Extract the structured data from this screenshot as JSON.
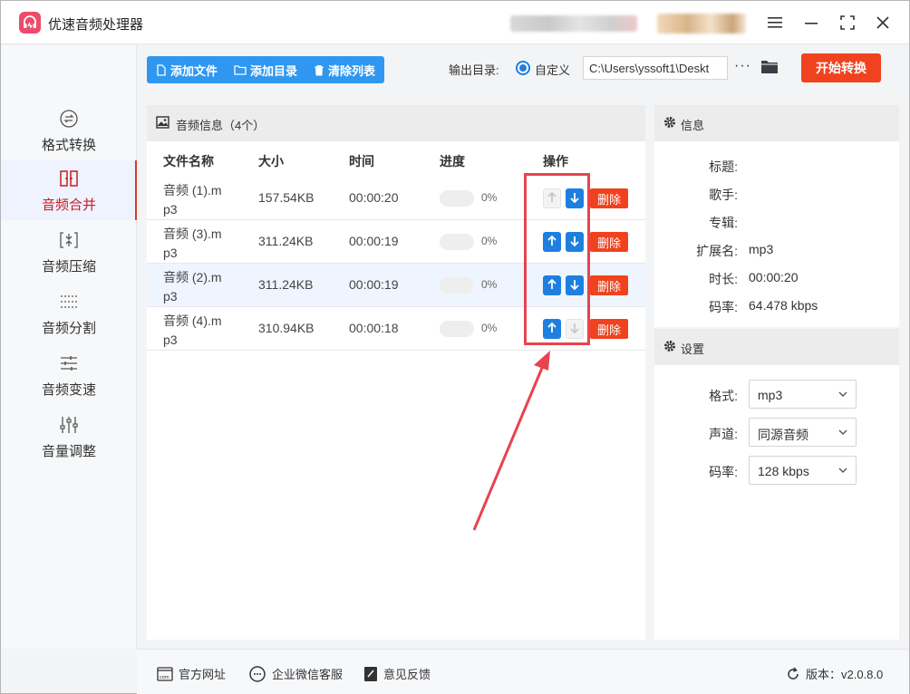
{
  "app": {
    "title": "优速音频处理器"
  },
  "sidebar": {
    "items": [
      {
        "label": "格式转换",
        "icon": "format-convert-icon",
        "active": false
      },
      {
        "label": "音频合并",
        "icon": "merge-icon",
        "active": true
      },
      {
        "label": "音频压缩",
        "icon": "compress-icon",
        "active": false
      },
      {
        "label": "音频分割",
        "icon": "split-icon",
        "active": false
      },
      {
        "label": "音频变速",
        "icon": "speed-icon",
        "active": false
      },
      {
        "label": "音量调整",
        "icon": "volume-icon",
        "active": false
      }
    ]
  },
  "toolbar": {
    "add_file": "添加文件",
    "add_dir": "添加目录",
    "clear_list": "清除列表",
    "output_label": "输出目录:",
    "custom_label": "自定义",
    "output_path": "C:\\Users\\yssoft1\\Deskt",
    "more": "···",
    "start_button": "开始转换"
  },
  "list": {
    "header_title": "音频信息（4个）",
    "columns": {
      "name": "文件名称",
      "size": "大小",
      "time": "时间",
      "progress": "进度",
      "actions": "操作"
    },
    "rows": [
      {
        "name": "音频 (1).m p3",
        "size": "157.54KB",
        "time": "00:00:20",
        "progress": 0,
        "pct": "0%",
        "up_enabled": false,
        "down_enabled": true,
        "delete": "删除"
      },
      {
        "name": "音频 (3).m p3",
        "size": "311.24KB",
        "time": "00:00:19",
        "progress": 0,
        "pct": "0%",
        "up_enabled": true,
        "down_enabled": true,
        "delete": "删除"
      },
      {
        "name": "音频 (2).m p3",
        "size": "311.24KB",
        "time": "00:00:19",
        "progress": 0,
        "pct": "0%",
        "up_enabled": true,
        "down_enabled": true,
        "delete": "删除"
      },
      {
        "name": "音频 (4).m p3",
        "size": "310.94KB",
        "time": "00:00:18",
        "progress": 0,
        "pct": "0%",
        "up_enabled": true,
        "down_enabled": false,
        "delete": "删除"
      }
    ]
  },
  "info": {
    "title": "信息",
    "fields": [
      {
        "key": "标题:",
        "value": ""
      },
      {
        "key": "歌手:",
        "value": ""
      },
      {
        "key": "专辑:",
        "value": ""
      },
      {
        "key": "扩展名:",
        "value": "mp3"
      },
      {
        "key": "时长:",
        "value": "00:00:20"
      },
      {
        "key": "码率:",
        "value": "64.478 kbps"
      }
    ]
  },
  "settings": {
    "title": "设置",
    "fields": [
      {
        "key": "格式:",
        "value": "mp3"
      },
      {
        "key": "声道:",
        "value": "同源音频"
      },
      {
        "key": "码率:",
        "value": "128 kbps"
      }
    ]
  },
  "footer": {
    "website": "官方网址",
    "wechat": "企业微信客服",
    "feedback": "意见反馈",
    "version": "版本：v2.0.8.0"
  },
  "colors": {
    "accent_blue": "#1e7fe0",
    "toolbar_blue": "#2f97f0",
    "danger_red": "#f0421e",
    "annotation_red": "#e8434e",
    "active_nav_red": "#c81e1e"
  }
}
